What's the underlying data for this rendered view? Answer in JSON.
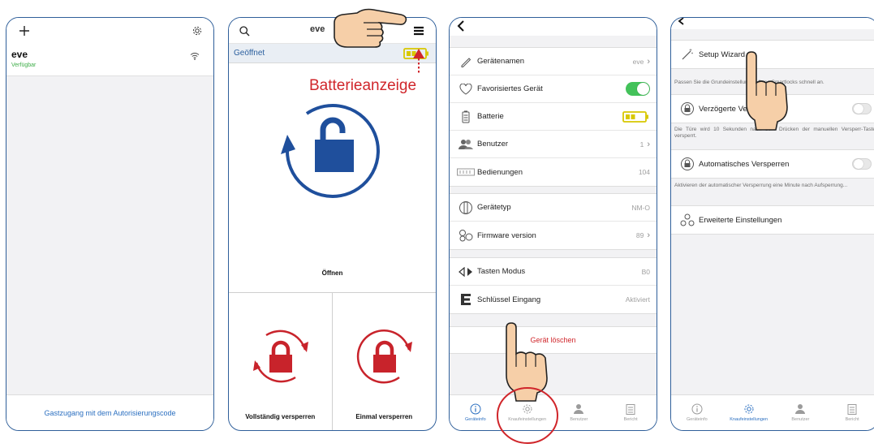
{
  "annotation": {
    "battery_callout": "Batterieanzeige",
    "accent": "#d0262b"
  },
  "phone1": {
    "device": {
      "name": "eve",
      "status": "Verfügbar"
    },
    "guest_access": "Gastzugang mit dem Autorisierungscode",
    "icons": [
      "plus-icon",
      "gear-icon",
      "wifi-icon"
    ]
  },
  "phone2": {
    "title": "eve",
    "status": "Geöffnet",
    "open_label": "Öffnen",
    "lock_full_label": "Vollständig versperren",
    "lock_once_label": "Einmal versperren",
    "colors": {
      "unlock": "#1f4f9c",
      "lock": "#c8232b",
      "battery": "#d8c800"
    }
  },
  "phone3": {
    "group1": [
      {
        "label": "Gerätenamen",
        "value": "eve",
        "icon": "pencil-icon",
        "chevron": true
      },
      {
        "label": "Favorisiertes Gerät",
        "icon": "heart-icon",
        "toggle": "on"
      },
      {
        "label": "Batterie",
        "icon": "battery-icon",
        "battery": true
      },
      {
        "label": "Benutzer",
        "value": "1",
        "icon": "users-icon",
        "chevron": true
      },
      {
        "label": "Bedienungen",
        "value": "104",
        "icon": "counter-icon"
      }
    ],
    "group2": [
      {
        "label": "Gerätetyp",
        "value": "NM-O",
        "icon": "cylinder-icon"
      },
      {
        "label": "Firmware version",
        "value": "89",
        "icon": "gears-icon",
        "chevron": true
      }
    ],
    "group3": [
      {
        "label": "Tasten Modus",
        "value": "B0",
        "icon": "arrows-icon"
      },
      {
        "label": "Schlüssel Eingang",
        "value": "Aktiviert",
        "icon": "key-e-icon"
      }
    ],
    "delete_label": "Gerät löschen",
    "tabs": [
      {
        "label": "Geräteinfo",
        "active": true
      },
      {
        "label": "Knaufeinstellungen",
        "active": false
      },
      {
        "label": "Benutzer",
        "active": false
      },
      {
        "label": "Bericht",
        "active": false
      }
    ]
  },
  "phone4": {
    "setup_wizard": "Setup Wizard",
    "wizard_desc": "Passen Sie die Grundeinstellungen Ihres Smartlocks schnell an.",
    "delayed_lock": "Verzögerte Versperrung",
    "delayed_desc": "Die Türe wird 10 Sekunden nach dem Drücken der manuellen Versperr-Taste versperrt.",
    "auto_lock": "Automatisches Versperren",
    "auto_desc": "Aktivieren der automatischer Versperrung eine Minute nach Aufsperrung...",
    "advanced": "Erweiterte Einstellungen",
    "tabs": [
      {
        "label": "Geräteinfo",
        "active": false
      },
      {
        "label": "Knaufeinstellungen",
        "active": true
      },
      {
        "label": "Benutzer",
        "active": false
      },
      {
        "label": "Bericht",
        "active": false
      }
    ]
  }
}
